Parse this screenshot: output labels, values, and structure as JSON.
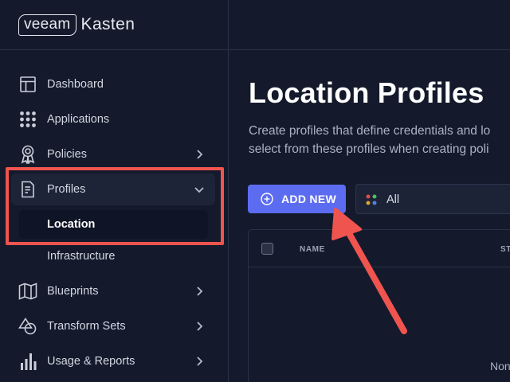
{
  "brand": {
    "logo": "veeam",
    "product": "Kasten"
  },
  "nav": {
    "items": [
      {
        "label": "Dashboard",
        "icon": "dashboard-icon"
      },
      {
        "label": "Applications",
        "icon": "grid-dots-icon"
      },
      {
        "label": "Policies",
        "icon": "badge-icon",
        "has_submenu": true
      },
      {
        "label": "Profiles",
        "icon": "document-icon",
        "expanded": true
      },
      {
        "label": "Blueprints",
        "icon": "map-icon",
        "has_submenu": true
      },
      {
        "label": "Transform Sets",
        "icon": "shapes-icon",
        "has_submenu": true
      },
      {
        "label": "Usage & Reports",
        "icon": "bar-chart-icon",
        "has_submenu": true
      }
    ],
    "profiles_sub": [
      {
        "label": "Location",
        "selected": true
      },
      {
        "label": "Infrastructure",
        "selected": false
      }
    ]
  },
  "main": {
    "title": "Location Profiles",
    "description_line1": "Create profiles that define credentials and lo",
    "description_line2": "select from these profiles when creating poli",
    "add_button": "ADD NEW",
    "filter_value": "All",
    "table": {
      "columns": [
        "NAME",
        "STA"
      ],
      "empty_text": "Non"
    }
  },
  "colors": {
    "background": "#141a2b",
    "accent": "#5c6cf0",
    "annotation": "#f0544f"
  }
}
